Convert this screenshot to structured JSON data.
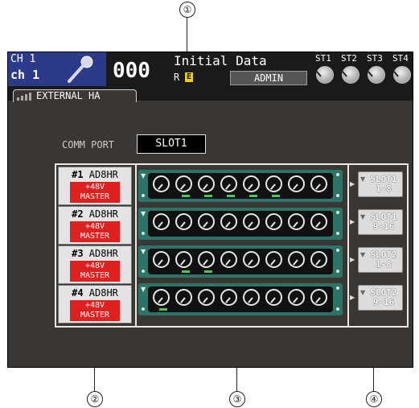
{
  "callouts": {
    "c1": "①",
    "c2": "②",
    "c3": "③",
    "c4": "④"
  },
  "header": {
    "channel_number": "CH 1",
    "channel_name": "ch 1",
    "channel_icon": "microphone-icon",
    "scene_number": "000",
    "scene_title": "Initial Data",
    "scene_flag_r": "R",
    "scene_flag_e": "E",
    "user_level": "ADMIN",
    "stereo_labels": [
      "ST1",
      "ST2",
      "ST3",
      "ST4"
    ]
  },
  "tab": {
    "label": "EXTERNAL HA"
  },
  "comm_port": {
    "label": "COMM PORT",
    "value": "SLOT1"
  },
  "units": [
    {
      "index": "#1",
      "model": "AD8HR",
      "phantom": "+48V",
      "master": "MASTER",
      "leds_on": [
        2,
        3,
        4,
        5,
        6
      ]
    },
    {
      "index": "#2",
      "model": "AD8HR",
      "phantom": "+48V",
      "master": "MASTER",
      "leds_on": []
    },
    {
      "index": "#3",
      "model": "AD8HR",
      "phantom": "+48V",
      "master": "MASTER",
      "leds_on": [
        2,
        3
      ]
    },
    {
      "index": "#4",
      "model": "AD8HR",
      "phantom": "+48V",
      "master": "MASTER",
      "leds_on": [
        1
      ]
    }
  ],
  "slots": [
    {
      "line1": "SLOT1",
      "line2": "1-8"
    },
    {
      "line1": "SLOT1",
      "line2": "9-16"
    },
    {
      "line1": "SLOT2",
      "line2": "1-8"
    },
    {
      "line1": "SLOT2",
      "line2": "9-16"
    }
  ],
  "colors": {
    "panel_bg": "#3a3633",
    "channel_bg": "#2c3a8a",
    "rack_green": "#2d7468",
    "master_red": "#e01f1f",
    "led_green": "#4fc25a"
  }
}
